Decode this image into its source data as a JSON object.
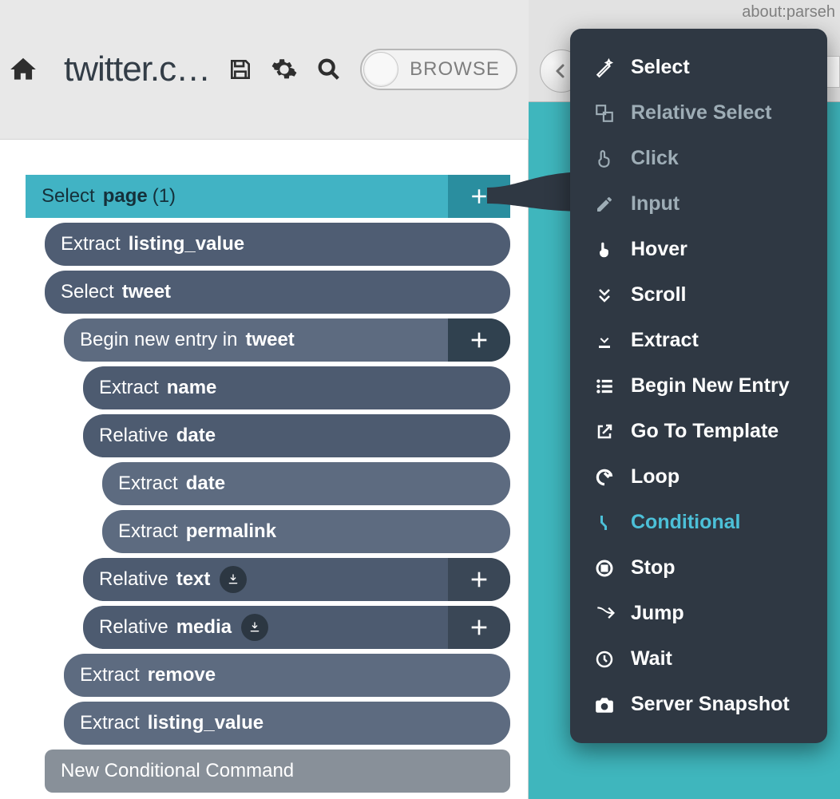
{
  "header": {
    "title": "twitter.c…",
    "browse_label": "BROWSE",
    "address": "about:parseh"
  },
  "tree": {
    "select_page": {
      "cmd": "Select",
      "arg": "page",
      "count": "(1)"
    },
    "extract_listing_value_1": {
      "cmd": "Extract",
      "arg": "listing_value"
    },
    "select_tweet": {
      "cmd": "Select",
      "arg": "tweet"
    },
    "begin_entry": {
      "cmd": "Begin new entry in",
      "arg": "tweet"
    },
    "extract_name": {
      "cmd": "Extract",
      "arg": "name"
    },
    "relative_date": {
      "cmd": "Relative",
      "arg": "date"
    },
    "extract_date": {
      "cmd": "Extract",
      "arg": "date"
    },
    "extract_permalink": {
      "cmd": "Extract",
      "arg": "permalink"
    },
    "relative_text": {
      "cmd": "Relative",
      "arg": "text"
    },
    "relative_media": {
      "cmd": "Relative",
      "arg": "media"
    },
    "extract_remove": {
      "cmd": "Extract",
      "arg": "remove"
    },
    "extract_listing_value_2": {
      "cmd": "Extract",
      "arg": "listing_value"
    },
    "new_conditional": "New Conditional Command"
  },
  "menu": {
    "select": "Select",
    "relative_select": "Relative Select",
    "click": "Click",
    "input": "Input",
    "hover": "Hover",
    "scroll": "Scroll",
    "extract": "Extract",
    "begin_new_entry": "Begin New Entry",
    "go_to_template": "Go To Template",
    "loop": "Loop",
    "conditional": "Conditional",
    "stop": "Stop",
    "jump": "Jump",
    "wait": "Wait",
    "server_snapshot": "Server Snapshot"
  }
}
